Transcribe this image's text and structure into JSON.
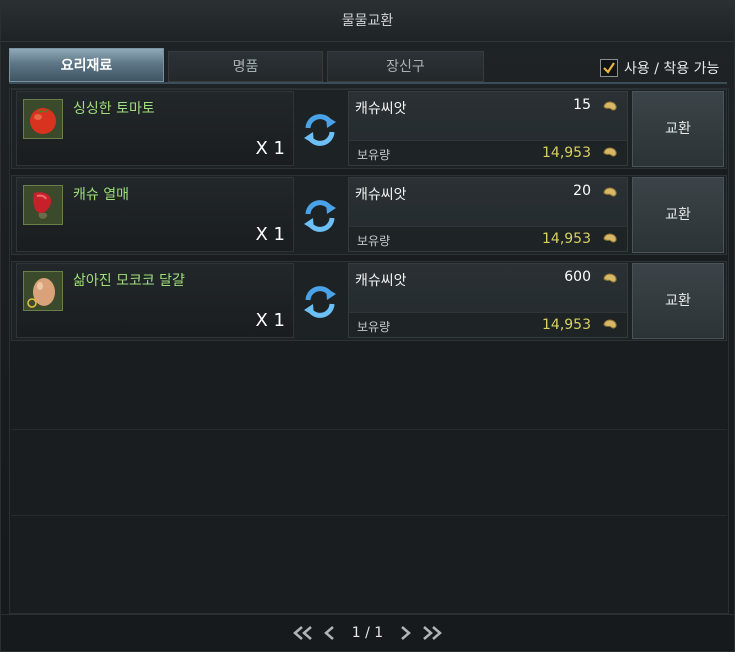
{
  "window": {
    "title": "물물교환"
  },
  "tabs": [
    {
      "label": "요리재료",
      "active": true
    },
    {
      "label": "명품",
      "active": false
    },
    {
      "label": "장신구",
      "active": false
    }
  ],
  "filter": {
    "label": "사용 / 착용 가능",
    "checked": true
  },
  "rows": [
    {
      "item_name": "싱싱한 토마토",
      "item_qty": "X 1",
      "icon": "tomato-icon",
      "cost_name": "캐슈씨앗",
      "cost_amount": "15",
      "owned_label": "보유량",
      "owned_amount": "14,953",
      "button": "교환"
    },
    {
      "item_name": "캐슈 열매",
      "item_qty": "X 1",
      "icon": "cashew-fruit-icon",
      "cost_name": "캐슈씨앗",
      "cost_amount": "20",
      "owned_label": "보유량",
      "owned_amount": "14,953",
      "button": "교환"
    },
    {
      "item_name": "삶아진 모코코 달걀",
      "item_qty": "X 1",
      "icon": "egg-icon",
      "cost_name": "캐슈씨앗",
      "cost_amount": "600",
      "owned_label": "보유량",
      "owned_amount": "14,953",
      "button": "교환"
    }
  ],
  "pager": {
    "text": "1 / 1"
  },
  "colors": {
    "item_name": "#9fe07a",
    "owned_amount": "#d8d060",
    "active_tab": "#5d7786"
  }
}
